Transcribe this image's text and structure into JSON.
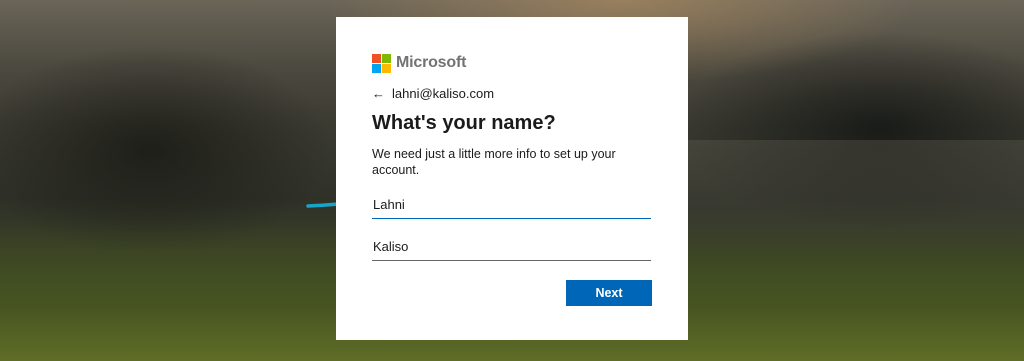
{
  "brand": {
    "name": "Microsoft",
    "logo_colors": [
      "#f25022",
      "#7fba00",
      "#00a4ef",
      "#ffb900"
    ]
  },
  "identity": {
    "back_icon": "←",
    "email": "lahni@kaliso.com"
  },
  "form": {
    "title": "What's your name?",
    "description": "We need just a little more info to set up your account.",
    "first_name": {
      "value": "Lahni"
    },
    "last_name": {
      "value": "Kaliso"
    },
    "next_label": "Next"
  },
  "colors": {
    "accent": "#0067b8",
    "annotation_arrow": "#1aa3c8"
  }
}
